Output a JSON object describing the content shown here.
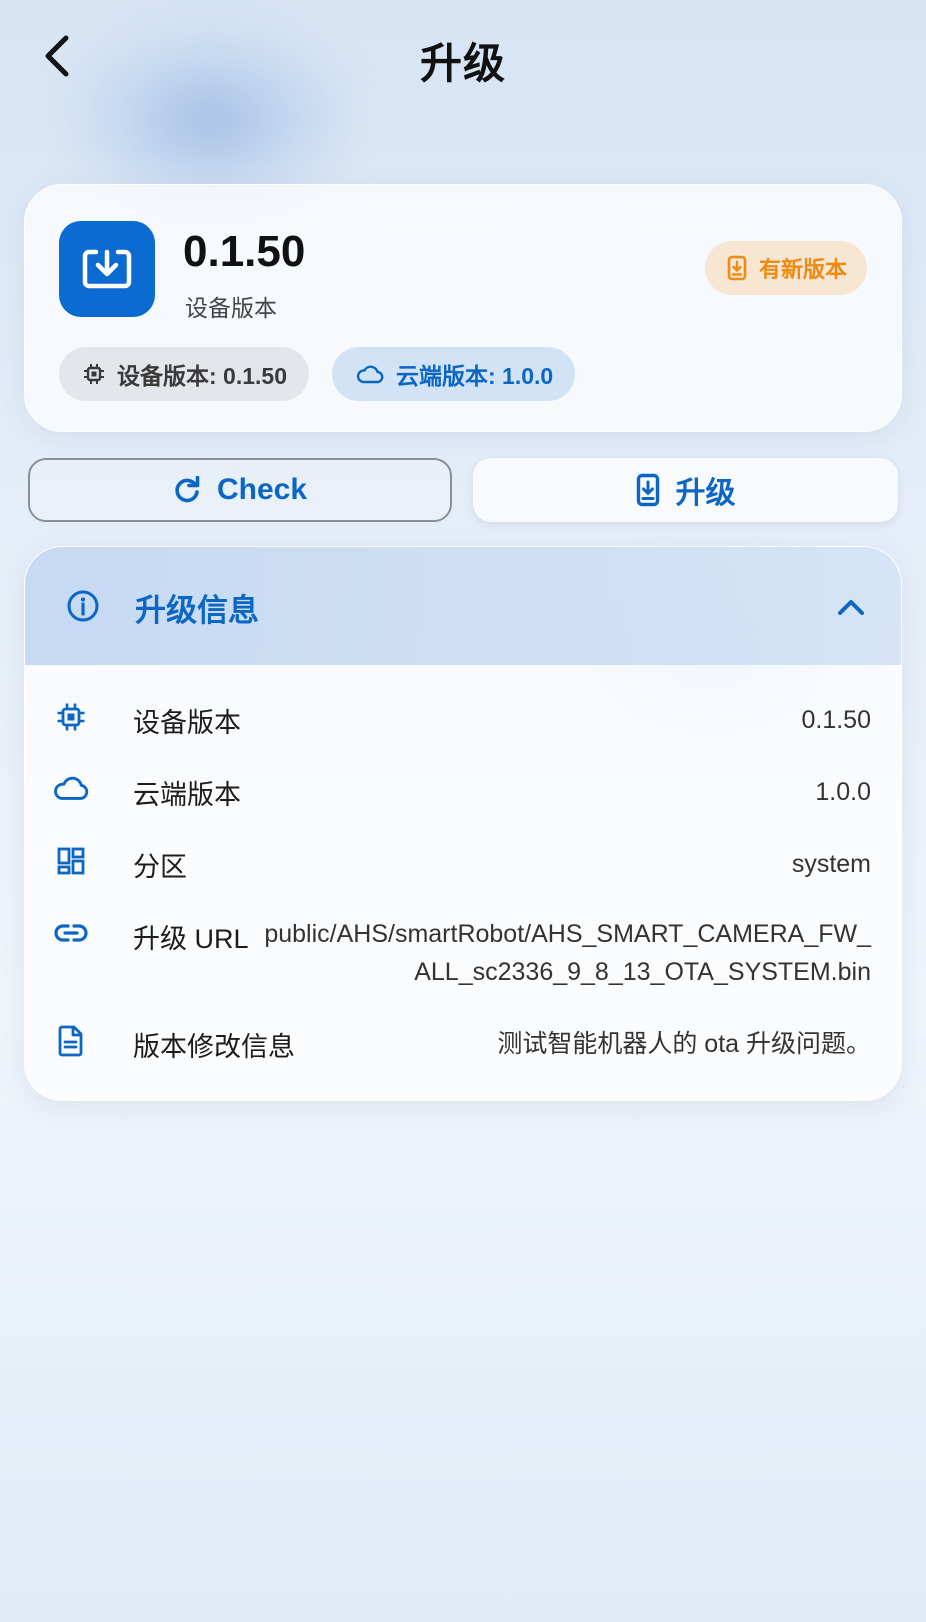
{
  "header": {
    "title": "升级",
    "back_icon": "chevron-left-icon"
  },
  "version_card": {
    "icon": "download-box-icon",
    "version": "0.1.50",
    "caption": "设备版本",
    "new_badge": {
      "icon": "phone-download-icon",
      "label": "有新版本"
    },
    "chips": {
      "device": {
        "icon": "chip-icon",
        "label": "设备版本: 0.1.50"
      },
      "cloud": {
        "icon": "cloud-icon",
        "label": "云端版本: 1.0.0"
      }
    }
  },
  "actions": {
    "check": {
      "icon": "refresh-icon",
      "label": "Check"
    },
    "upgrade": {
      "icon": "phone-download-icon",
      "label": "升级"
    }
  },
  "info_panel": {
    "title": "升级信息",
    "icon": "info-icon",
    "expanded": true,
    "rows": [
      {
        "icon": "chip-icon",
        "label": "设备版本",
        "value": "0.1.50"
      },
      {
        "icon": "cloud-icon",
        "label": "云端版本",
        "value": "1.0.0"
      },
      {
        "icon": "dashboard-icon",
        "label": "分区",
        "value": "system"
      },
      {
        "icon": "link-icon",
        "label": "升级 URL",
        "value": "public/AHS/smartRobot/AHS_SMART_CAMERA_FW_ALL_sc2336_9_8_13_OTA_SYSTEM.bin"
      },
      {
        "icon": "document-icon",
        "label": "版本修改信息",
        "value": "测试智能机器人的 ota 升级问题。"
      }
    ]
  },
  "colors": {
    "primary": "#0b66c4",
    "app_icon_bg": "#0b6bd1",
    "warning": "#ef8a13",
    "warning_bg": "#f6e6d2"
  }
}
